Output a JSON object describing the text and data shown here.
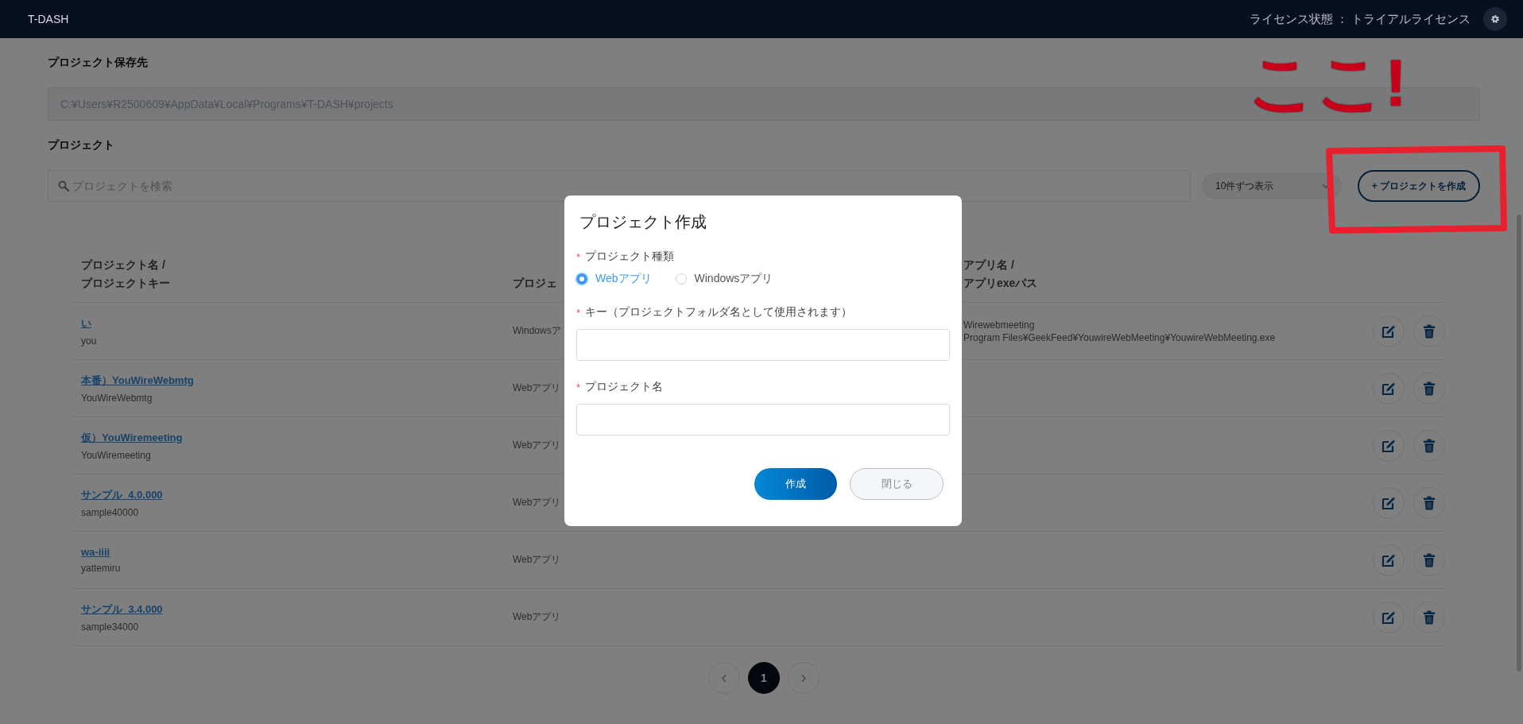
{
  "header": {
    "app_title": "T-DASH",
    "license_status": "ライセンス状態 ： トライアルライセンス"
  },
  "storage": {
    "label": "プロジェクト保存先",
    "path": "C:¥Users¥R2500609¥AppData¥Local¥Programs¥T-DASH¥projects"
  },
  "projects": {
    "label": "プロジェクト",
    "search_placeholder": "プロジェクトを検索",
    "page_size": "10件ずつ表示",
    "create_button": "+ プロジェクトを作成"
  },
  "table": {
    "columns": [
      {
        "lines": [
          "プロジェクト名 /",
          "プロジェクトキー"
        ]
      },
      {
        "lines": [
          "プロジェ"
        ]
      },
      {
        "lines": [
          "アプリ名 /",
          "アプリexeパス"
        ]
      }
    ],
    "rows": [
      {
        "name": "い",
        "key": "you",
        "type": "Windowsア",
        "app_lines": [
          "Wirewebmeeting",
          "Program Files¥GeekFeed¥YouwireWebMeeting¥YouwireWebMeeting.exe"
        ]
      },
      {
        "name": "本番）YouWireWebmtg",
        "key": "YouWireWebmtg",
        "type": "Webアプリ",
        "app_lines": []
      },
      {
        "name": "仮）YouWiremeeting",
        "key": "YouWiremeeting",
        "type": "Webアプリ",
        "app_lines": []
      },
      {
        "name": "サンプル_4.0.000",
        "key": "sample40000",
        "type": "Webアプリ",
        "app_lines": []
      },
      {
        "name": "wa-iiii",
        "key": "yattemiru",
        "type": "Webアプリ",
        "app_lines": []
      },
      {
        "name": "サンプル_3.4.000",
        "key": "sample34000",
        "type": "Webアプリ",
        "app_lines": []
      }
    ]
  },
  "pagination": {
    "previous": "‹",
    "pages": [
      {
        "label": "1",
        "selected": true
      }
    ],
    "next": "›"
  },
  "dialog": {
    "title": "プロジェクト作成",
    "fields": [
      {
        "kind": "radio",
        "label": "プロジェクト種類",
        "required_mark": "*",
        "options": [
          {
            "label": "Webアプリ",
            "selected": true
          },
          {
            "label": "Windowsアプリ",
            "selected": false
          }
        ]
      },
      {
        "kind": "text",
        "label": "キー（プロジェクトフォルダ名として使用されます）",
        "required_mark": "*"
      },
      {
        "kind": "text",
        "label": "プロジェクト名",
        "required_mark": "*"
      }
    ],
    "buttons": [
      {
        "kind": "primary",
        "label": "作成"
      },
      {
        "kind": "secondary",
        "label": "閉じる"
      }
    ]
  },
  "annotation": {
    "text": "ここ!"
  }
}
